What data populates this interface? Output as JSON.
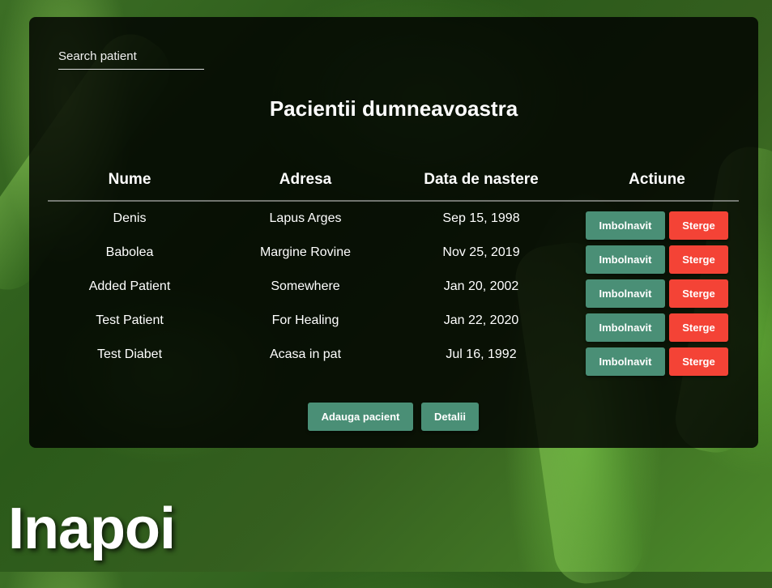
{
  "search": {
    "placeholder": "Search patient"
  },
  "title": "Pacientii dumneavoastra",
  "table": {
    "headers": [
      "Nume",
      "Adresa",
      "Data de nastere",
      "Actiune"
    ],
    "rows": [
      {
        "name": "Denis",
        "address": "Lapus Arges",
        "birth": "Sep 15, 1998"
      },
      {
        "name": "Babolea",
        "address": "Margine Rovine",
        "birth": "Nov 25, 2019"
      },
      {
        "name": "Added Patient",
        "address": "Somewhere",
        "birth": "Jan 20, 2002"
      },
      {
        "name": "Test Patient",
        "address": "For Healing",
        "birth": "Jan 22, 2020"
      },
      {
        "name": "Test Diabet",
        "address": "Acasa in pat",
        "birth": "Jul 16, 1992"
      }
    ],
    "action_sick_label": "Imbolnavit",
    "action_delete_label": "Sterge"
  },
  "footer": {
    "add_label": "Adauga pacient",
    "details_label": "Detalii"
  },
  "back_label": "Inapoi",
  "colors": {
    "accent_green": "#4a8f76",
    "danger_red": "#f44336",
    "panel_bg": "rgba(0,0,0,0.82)"
  }
}
